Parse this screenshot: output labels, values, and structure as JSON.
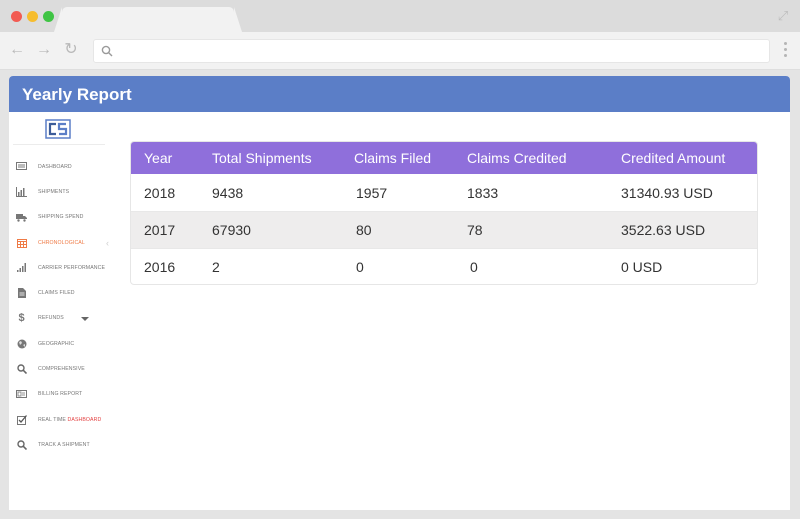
{
  "app": {
    "title": "Yearly Report"
  },
  "sidebar": {
    "items": [
      {
        "label": "DASHBOARD",
        "icon": "monitor-icon"
      },
      {
        "label": "SHIPMENTS",
        "icon": "bar-chart-icon"
      },
      {
        "label": "SHIPPING SPEND",
        "icon": "truck-icon"
      },
      {
        "label": "CHRONOLOGICAL",
        "icon": "calendar-icon",
        "active": true
      },
      {
        "label": "CARRIER PERFORMANCE",
        "icon": "signal-bars-icon"
      },
      {
        "label": "CLAIMS FILED",
        "icon": "document-icon"
      },
      {
        "label": "REFUNDS",
        "icon": "dollar-icon"
      },
      {
        "label": "GEOGRAPHIC",
        "icon": "globe-icon"
      },
      {
        "label": "COMPREHENSIVE",
        "icon": "search-icon"
      },
      {
        "label": "BILLING REPORT",
        "icon": "billing-icon"
      },
      {
        "label": "REAL TIME",
        "label_accent": "DASHBOARD",
        "icon": "checkbox-icon"
      },
      {
        "label": "TRACK A SHIPMENT",
        "icon": "search-icon"
      }
    ]
  },
  "table": {
    "headers": [
      "Year",
      "Total Shipments",
      "Claims Filed",
      "Claims Credited",
      "Credited Amount"
    ],
    "rows": [
      [
        "2018",
        "9438",
        "1957",
        "1833",
        "31340.93 USD"
      ],
      [
        "2017",
        "67930",
        "80",
        "78",
        "3522.63 USD"
      ],
      [
        "2016",
        "2",
        "0",
        "0",
        "0 USD"
      ]
    ]
  },
  "colors": {
    "header_bar": "#5b7ec7",
    "table_header": "#8f6fdb",
    "active_nav": "#ef7a45",
    "accent_red": "#e34141"
  }
}
